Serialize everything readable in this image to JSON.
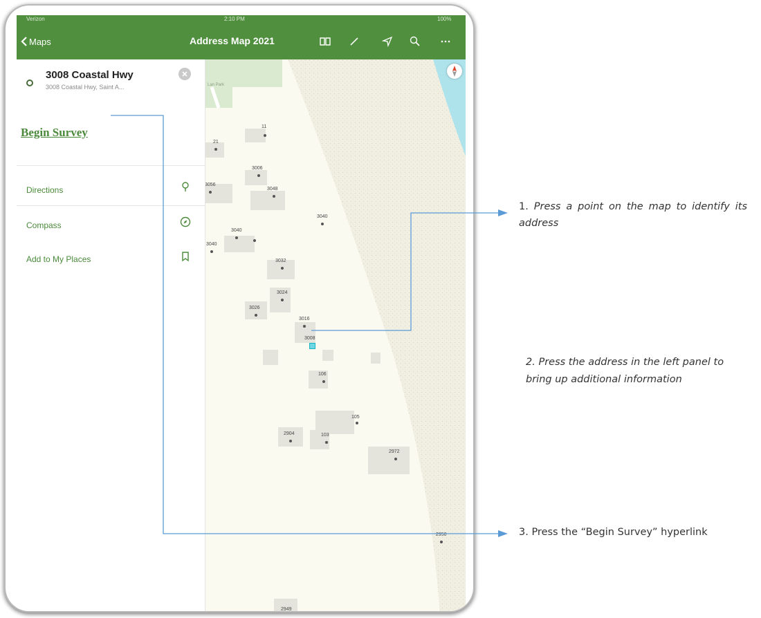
{
  "status_bar": {
    "carrier": "Verizon",
    "time": "2:10 PM",
    "battery": "100%"
  },
  "nav": {
    "back_label": "Maps",
    "title": "Address Map 2021",
    "icons": [
      "book-icon",
      "pencil-icon",
      "navigation-arrow-icon",
      "search-icon",
      "more-icon"
    ]
  },
  "panel": {
    "address_title": "3008 Coastal Hwy",
    "address_subtitle": "3008 Coastal Hwy, Saint A...",
    "begin_survey": "Begin Survey",
    "menu": [
      {
        "label": "Directions",
        "icon": "pin-icon"
      },
      {
        "label": "Compass",
        "icon": "compass-icon"
      },
      {
        "label": "Add to My Places",
        "icon": "bookmark-icon"
      }
    ]
  },
  "map": {
    "place_label": "Lan Park",
    "address_points": [
      "11",
      "21",
      "3006",
      "3056",
      "3048",
      "3040",
      "3040",
      "3040",
      "3032",
      "3024",
      "3026",
      "3016",
      "3008",
      "106",
      "105",
      "2904",
      "103",
      "2972",
      "2950",
      "2949"
    ]
  },
  "annotations": {
    "step1_number": "1.",
    "step1_text": "Press a point on the map to identify its address",
    "step2_text": "2. Press the address in the left panel to bring up additional information",
    "step3_text": "3. Press the “Begin Survey” hyperlink"
  },
  "colors": {
    "nav_green": "#4f8f3d",
    "link_green": "#4a8a3a",
    "water": "#aee3ec",
    "park": "#d9ead0",
    "connector_blue": "#5b9bd5"
  }
}
